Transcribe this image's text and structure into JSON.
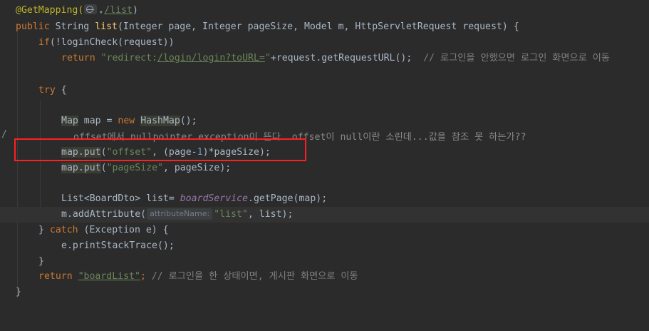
{
  "editor": {
    "lines": {
      "l1": {
        "annotation": "@GetMapping(",
        "path": "/list",
        "close": ")"
      },
      "l2": {
        "kw_public": "public",
        "type": "String",
        "method": "list",
        "params": "(Integer page, Integer pageSize, Model m, HttpServletRequest request) {"
      },
      "l3": {
        "kw_if": "if",
        "rest": "(!loginCheck(request))"
      },
      "l4": {
        "kw_return": "return",
        "str_prefix": "\"redirect:",
        "str_url": "/login/login?toURL=",
        "str_end": "\"",
        "rest": "+request.getRequestURL();",
        "comment": "// 로그인을 안했으면 로그인 화면으로 이동"
      },
      "l6": {
        "kw_try": "try",
        "rest": " {"
      },
      "l8": {
        "type": "Map",
        "mid": " map = ",
        "kw_new": "new",
        "cls": "HashMap",
        "end": "();"
      },
      "l9": {
        "text": "offset에서 nullpointer exception이 뜬다. offset이 null이란 소린데...값을 참조 못 하는가??"
      },
      "l10": {
        "obj": "map",
        "method": "put",
        "open": "(",
        "str": "\"offset\"",
        "mid": ", (page-",
        "num": "1",
        "end": ")*pageSize);"
      },
      "l11": {
        "obj": "map",
        "method": "put",
        "open": "(",
        "str": "\"pageSize\"",
        "end": ", pageSize);"
      },
      "l13": {
        "decl": "List<BoardDto> list= ",
        "svc": "boardService",
        "call": ".getPage(map);"
      },
      "l14": {
        "pre": "m.addAttribute(",
        "hint": "attributeName:",
        "str": "\"list\"",
        "end": ", list);"
      },
      "l15": {
        "pre": "} ",
        "kw_catch": "catch",
        "end": " (Exception e) {"
      },
      "l16": {
        "text": "e.printStackTrace();"
      },
      "l17": {
        "text": "}"
      },
      "l18": {
        "kw_return": "return",
        "str": "\"boardList\"",
        "end": ";",
        "comment": "// 로그인을 한 상태이면, 게시판 화면으로 이동"
      },
      "l19": {
        "text": "}"
      }
    },
    "gutter_mark": "/"
  },
  "colors": {
    "background": "#2b2b2b",
    "keyword": "#cc7832",
    "annotation": "#bbb529",
    "string": "#6a8759",
    "comment": "#808080",
    "method": "#ffc66d",
    "number": "#6897bb",
    "highlight_box": "#ff2020"
  },
  "icons": [
    "globe-icon",
    "chevron-down-icon"
  ]
}
